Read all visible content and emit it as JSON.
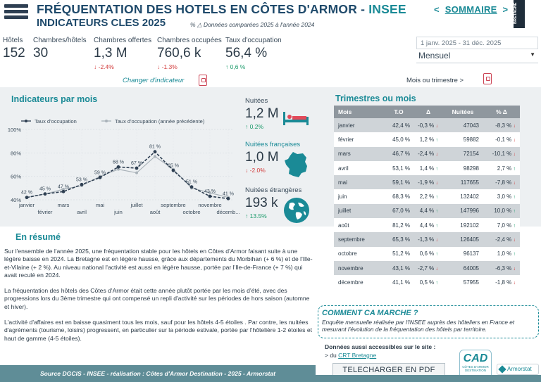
{
  "header": {
    "title_main": "FRÉQUENTATION DES HOTELS EN CÔTES D'ARMOR - ",
    "title_insee": "INSEE",
    "subtitle": "INDICATEURS CLES 2025",
    "compare_note": "% △ Données comparées 2025 à l'année 2024",
    "nav_prev": "<",
    "nav_label": "SOMMAIRE",
    "nav_next": ">",
    "badge_text": "BRETAGNE"
  },
  "kpis": [
    {
      "label": "Hôtels",
      "value": "152",
      "change": ""
    },
    {
      "label": "Chambres/hôtels",
      "value": "30",
      "change": ""
    },
    {
      "label": "Chambres offertes",
      "value": "1,3 M",
      "change": "-2.4%",
      "dir": "down"
    },
    {
      "label": "Chambres occupées",
      "value": "760,6 k",
      "change": "-1.3%",
      "dir": "down"
    },
    {
      "label": "Taux d'occupation",
      "value": "56,4 %",
      "change": "0,6 %",
      "dir": "up"
    }
  ],
  "filters": {
    "date_range": "1 janv. 2025 - 31 déc. 2025",
    "period": "Mensuel"
  },
  "links": {
    "change_indicator": "Changer d'indicateur",
    "month_or_quarter": "Mois ou trimestre >"
  },
  "chart_panel": {
    "title": "Indicateurs par mois"
  },
  "chart_data": {
    "type": "line",
    "categories": [
      "janvier",
      "février",
      "mars",
      "avril",
      "mai",
      "juin",
      "juillet",
      "août",
      "septembre",
      "octobre",
      "novembre",
      "décemb..."
    ],
    "series": [
      {
        "name": "Taux d'occupation",
        "values": [
          42,
          45,
          47,
          53,
          59,
          68,
          67,
          81,
          65,
          51,
          43,
          41
        ],
        "color": "#2e3f52"
      },
      {
        "name": "Taux d'occupation (année précédente)",
        "values": [
          42,
          45,
          49,
          52,
          60,
          66,
          63,
          77,
          66,
          50,
          46,
          42
        ],
        "color": "#a9b2b9"
      }
    ],
    "data_labels": [
      "42 %",
      "45 %",
      "47 %",
      "53 %",
      "59 %",
      "68 %",
      "67 %",
      "81 %",
      "65 %",
      "51 %",
      "43 %",
      "41 %"
    ],
    "y_ticks": [
      "100%",
      "80%",
      "60%",
      "40%"
    ],
    "ylim": [
      40,
      100
    ],
    "grid": true,
    "legend_placement": "top"
  },
  "side_metrics": [
    {
      "label": "Nuitées",
      "value": "1,2 M",
      "change": "0.2%",
      "dir": "up",
      "icon": "bed-icon"
    },
    {
      "label": "Nuitées françaises",
      "value": "1,0 M",
      "change": "-2.0%",
      "dir": "down",
      "icon": "france-map-icon"
    },
    {
      "label": "Nuitées étrangères",
      "value": "193 k",
      "change": "13.5%",
      "dir": "up",
      "icon": "globe-icon"
    }
  ],
  "table": {
    "title": "Trimestres ou mois",
    "headers": [
      "Mois",
      "T.O",
      "Δ",
      "Nuitées",
      "% Δ"
    ],
    "rows": [
      {
        "mois": "janvier",
        "to": "42,4 %",
        "delta": "-0,3 %",
        "ddir": "down",
        "nuitees": "47043",
        "pct": "-8,3 %",
        "pdir": "down"
      },
      {
        "mois": "février",
        "to": "45,0 %",
        "delta": "1,2 %",
        "ddir": "up",
        "nuitees": "59882",
        "pct": "-0,1 %",
        "pdir": "down"
      },
      {
        "mois": "mars",
        "to": "46,7 %",
        "delta": "-2,4 %",
        "ddir": "down",
        "nuitees": "72154",
        "pct": "-10,1 %",
        "pdir": "down"
      },
      {
        "mois": "avril",
        "to": "53,1 %",
        "delta": "1,4 %",
        "ddir": "up",
        "nuitees": "98298",
        "pct": "2,7 %",
        "pdir": "up"
      },
      {
        "mois": "mai",
        "to": "59,1 %",
        "delta": "-1,9 %",
        "ddir": "down",
        "nuitees": "117655",
        "pct": "-7,8 %",
        "pdir": "down"
      },
      {
        "mois": "juin",
        "to": "68,3 %",
        "delta": "2,2 %",
        "ddir": "up",
        "nuitees": "132402",
        "pct": "3,0 %",
        "pdir": "up"
      },
      {
        "mois": "juillet",
        "to": "67,0 %",
        "delta": "4,4 %",
        "ddir": "up",
        "nuitees": "147996",
        "pct": "10,0 %",
        "pdir": "up"
      },
      {
        "mois": "août",
        "to": "81,2 %",
        "delta": "4,4 %",
        "ddir": "up",
        "nuitees": "192102",
        "pct": "7,0 %",
        "pdir": "up"
      },
      {
        "mois": "septembre",
        "to": "65,3 %",
        "delta": "-1,3 %",
        "ddir": "down",
        "nuitees": "126405",
        "pct": "-2,4 %",
        "pdir": "down"
      },
      {
        "mois": "octobre",
        "to": "51,2 %",
        "delta": "0,6 %",
        "ddir": "up",
        "nuitees": "96137",
        "pct": "1,0 %",
        "pdir": "up"
      },
      {
        "mois": "novembre",
        "to": "43,1 %",
        "delta": "-2,7 %",
        "ddir": "down",
        "nuitees": "64005",
        "pct": "-6,3 %",
        "pdir": "down"
      },
      {
        "mois": "décembre",
        "to": "41,1 %",
        "delta": "0,5 %",
        "ddir": "up",
        "nuitees": "57955",
        "pct": "-1,8 %",
        "pdir": "down"
      }
    ]
  },
  "resume": {
    "title": "En résumé",
    "p1": "Sur l'ensemble de l'année 2025, une fréquentation stable pour les hôtels en Côtes d'Armor faisant suite à une légère baisse en 2024. La Bretagne est en légère hausse, grâce aux départements du Morbihan (+ 6 %) et de l'Ille-et-Vilaine (+ 2 %). Au niveau national l'activité est aussi en légère hausse, portée par l'Ile-de-France (+ 7 %) qui avait reculé en 2024.",
    "p2": "La fréquentation des hôtels des Côtes d'Armor était cette année plutôt portée par les mois d'été, avec des progressions lors du 3ème trimestre qui ont compensé un repli d'activité sur les périodes de hors saison (automne et hiver).",
    "p3": "L'activité d'affaires est en baisse quasiment tous les mois, sauf pour les hôtels 4-5 étoiles . Par contre, les nuitées d'agréments (tourisme, loisirs) progressent, en particulier sur la période estivale, portée par l'hôtelière 1-2 étoiles et haut de gamme (4-5 étoiles)."
  },
  "how": {
    "title": "COMMENT CA MARCHE ?",
    "body": "Enquête mensuelle réalisée par l'INSEE auprès des hôteliers en France et mesurant l'évolution de la fréquentation des hôtels par territoire."
  },
  "access": {
    "label": "Données aussi accessibles sur le site :",
    "prefix": "> du ",
    "link": "CRT Bretagne"
  },
  "download_label": "TELECHARGER EN PDF",
  "footer": "Source DGCIS - INSEE - réalisation : Côtes d'Armor Destination - 2025 - Armorstat",
  "logos": {
    "cad": "CAD",
    "cad_sub": "CÔTES D'ARMOR DESTINATION",
    "armorstat": "Armorstat"
  }
}
